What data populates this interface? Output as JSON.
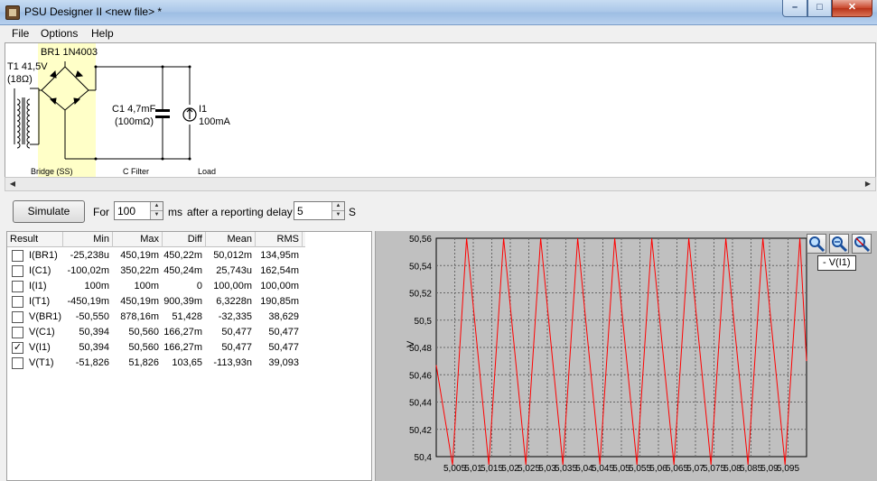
{
  "window": {
    "title": "PSU Designer II  <new file> *"
  },
  "menu": [
    "File",
    "Options",
    "Help"
  ],
  "schematic": {
    "transformer": {
      "label": "T1 41,5V",
      "resistance": "(18Ω)"
    },
    "bridge": {
      "label": "BR1 1N4003",
      "section": "Bridge (SS)"
    },
    "capacitor": {
      "label": "C1 4,7mF",
      "esr": "(100mΩ)",
      "section": "C Filter"
    },
    "load": {
      "label": "I1",
      "value": "100mA",
      "section": "Load"
    }
  },
  "controls": {
    "simulate_label": "Simulate",
    "for_label": "For",
    "duration": "100",
    "ms_label": "ms",
    "delay_label": "after a reporting delay of",
    "delay": "5",
    "s_label": "S"
  },
  "results": {
    "columns": [
      "Result",
      "Min",
      "Max",
      "Diff",
      "Mean",
      "RMS"
    ],
    "rows": [
      {
        "name": "I(BR1)",
        "min": "-25,238u",
        "max": "450,19m",
        "diff": "450,22m",
        "mean": "50,012m",
        "rms": "134,95m",
        "checked": false
      },
      {
        "name": "I(C1)",
        "min": "-100,02m",
        "max": "350,22m",
        "diff": "450,24m",
        "mean": "25,743u",
        "rms": "162,54m",
        "checked": false
      },
      {
        "name": "I(I1)",
        "min": "100m",
        "max": "100m",
        "diff": "0",
        "mean": "100,00m",
        "rms": "100,00m",
        "checked": false
      },
      {
        "name": "I(T1)",
        "min": "-450,19m",
        "max": "450,19m",
        "diff": "900,39m",
        "mean": "6,3228n",
        "rms": "190,85m",
        "checked": false
      },
      {
        "name": "V(BR1)",
        "min": "-50,550",
        "max": "878,16m",
        "diff": "51,428",
        "mean": "-32,335",
        "rms": "38,629",
        "checked": false
      },
      {
        "name": "V(C1)",
        "min": "50,394",
        "max": "50,560",
        "diff": "166,27m",
        "mean": "50,477",
        "rms": "50,477",
        "checked": false
      },
      {
        "name": "V(I1)",
        "min": "50,394",
        "max": "50,560",
        "diff": "166,27m",
        "mean": "50,477",
        "rms": "50,477",
        "checked": true
      },
      {
        "name": "V(T1)",
        "min": "-51,826",
        "max": "51,826",
        "diff": "103,65",
        "mean": "-113,93n",
        "rms": "39,093",
        "checked": false
      }
    ]
  },
  "graph": {
    "tooltip": "- V(I1)",
    "zoom_icons": [
      "zoom-in-icon",
      "zoom-out-icon",
      "zoom-reset-icon"
    ],
    "colors": {
      "line": "#ff0000",
      "plot_bg": "#c0c0c0"
    }
  },
  "chart_data": {
    "type": "line",
    "title": "",
    "xlabel": "",
    "ylabel": "V",
    "xlim": [
      5.0,
      5.1
    ],
    "ylim": [
      50.4,
      50.56
    ],
    "yticks": [
      "50,56",
      "50,54",
      "50,52",
      "50,5",
      "50,48",
      "50,46",
      "50,44",
      "50,42",
      "50,4"
    ],
    "xticks": [
      "5,005",
      "5,01",
      "5,015",
      "5,02",
      "5,025",
      "5,03",
      "5,035",
      "5,04",
      "5,045",
      "5,05",
      "5,055",
      "5,06",
      "5,065",
      "5,07",
      "5,075",
      "5,08",
      "5,085",
      "5,09",
      "5,095"
    ],
    "grid": true,
    "series": [
      {
        "name": "V(I1)",
        "x": [
          5.0,
          5.0044,
          5.0082,
          5.0142,
          5.0182,
          5.0242,
          5.0282,
          5.0342,
          5.0382,
          5.0442,
          5.0482,
          5.0542,
          5.0582,
          5.0642,
          5.0682,
          5.0742,
          5.0782,
          5.0842,
          5.0882,
          5.0942,
          5.0982,
          5.1
        ],
        "y": [
          50.467,
          50.394,
          50.56,
          50.394,
          50.56,
          50.394,
          50.56,
          50.394,
          50.56,
          50.394,
          50.56,
          50.394,
          50.56,
          50.394,
          50.56,
          50.394,
          50.56,
          50.394,
          50.56,
          50.394,
          50.56,
          50.47
        ]
      }
    ]
  }
}
